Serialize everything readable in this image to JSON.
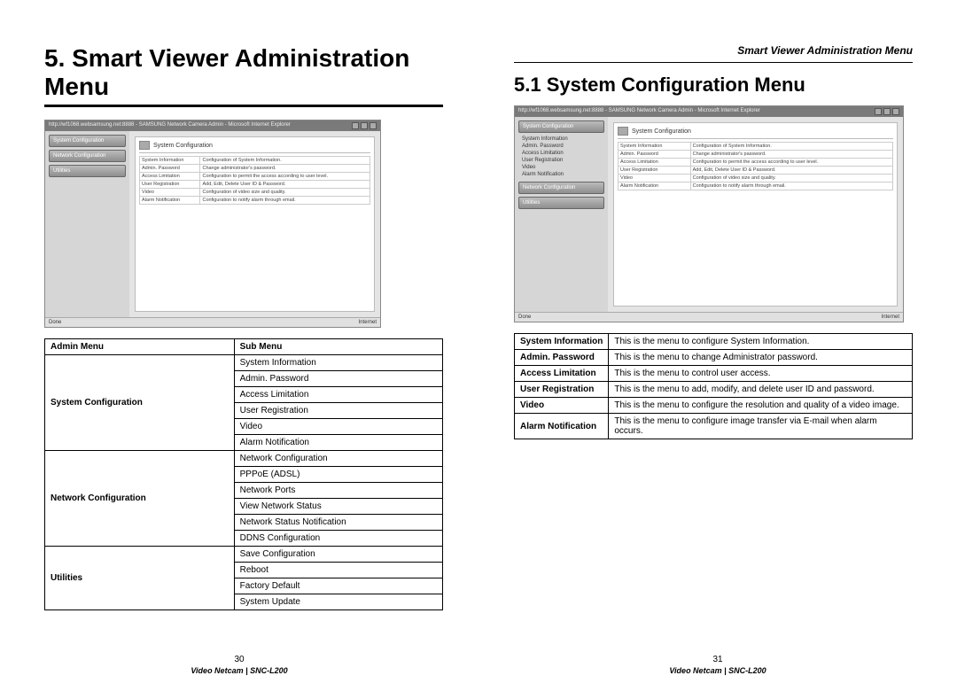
{
  "left": {
    "title": "5. Smart Viewer Administration Menu",
    "screenshot": {
      "titlebar": "http://wf1068.websamsung.net:8888 - SAMSUNG Network Camera Admin - Microsoft Internet Explorer",
      "side": {
        "sysconf": "System Configuration",
        "netconf": "Network Configuration",
        "util": "Utilities"
      },
      "main_title": "System Configuration",
      "rows": [
        {
          "k": "System Information",
          "v": "Configuration of System Information."
        },
        {
          "k": "Admin. Password",
          "v": "Change administrator's password."
        },
        {
          "k": "Access Limitation",
          "v": "Configuration to permit the access according to user level."
        },
        {
          "k": "User Registration",
          "v": "Add, Edit, Delete User ID & Password."
        },
        {
          "k": "Video",
          "v": "Configuration of video size and quality."
        },
        {
          "k": "Alarm Notification",
          "v": "Configuration to notify alarm through email."
        }
      ],
      "status_done": "Done",
      "status_net": "Internet"
    },
    "admin_table": {
      "headers": {
        "c1": "Admin Menu",
        "c2": "Sub Menu"
      },
      "groups": [
        {
          "label": "System Configuration",
          "items": [
            "System Information",
            "Admin. Password",
            "Access Limitation",
            "User Registration",
            "Video",
            "Alarm Notification"
          ]
        },
        {
          "label": "Network Configuration",
          "items": [
            "Network Configuration",
            "PPPoE (ADSL)",
            "Network Ports",
            "View Network Status",
            "Network Status Notification",
            "DDNS Configuration"
          ]
        },
        {
          "label": "Utilities",
          "items": [
            "Save Configuration",
            "Reboot",
            "Factory Default",
            "System Update"
          ]
        }
      ]
    },
    "page_number": "30",
    "model": "Video Netcam | SNC-L200"
  },
  "right": {
    "running_head": "Smart Viewer Administration Menu",
    "title": "5.1 System Configuration Menu",
    "screenshot": {
      "titlebar": "http://wf1068.websamsung.net:8888 - SAMSUNG Network Camera Admin - Microsoft Internet Explorer",
      "side": {
        "sysconf": "System Configuration",
        "subs": [
          "System Information",
          "Admin. Password",
          "Access Limitation",
          "User Registration",
          "Video",
          "Alarm Notification"
        ],
        "netconf": "Network Configuration",
        "util": "Utilities"
      },
      "main_title": "System Configuration",
      "rows": [
        {
          "k": "System Information",
          "v": "Configuration of System Information."
        },
        {
          "k": "Admin. Password",
          "v": "Change administrator's password."
        },
        {
          "k": "Access Limitation",
          "v": "Configuration to permit the access according to user level."
        },
        {
          "k": "User Registration",
          "v": "Add, Edit, Delete User ID & Password."
        },
        {
          "k": "Video",
          "v": "Configuration of video size and quality."
        },
        {
          "k": "Alarm Notification",
          "v": "Configuration to notify alarm through email."
        }
      ],
      "status_done": "Done",
      "status_net": "Internet"
    },
    "desc_table": [
      {
        "label": "System Information",
        "desc": "This is the menu to configure System Information."
      },
      {
        "label": "Admin. Password",
        "desc": "This is the menu to change Administrator password."
      },
      {
        "label": "Access Limitation",
        "desc": "This is the menu to control user access."
      },
      {
        "label": "User Registration",
        "desc": "This is the menu to add, modify, and delete user ID and password."
      },
      {
        "label": "Video",
        "desc": "This is the menu to configure the resolution and quality of a video image."
      },
      {
        "label": "Alarm Notification",
        "desc": "This is the menu to configure image transfer via E-mail when alarm occurs."
      }
    ],
    "page_number": "31",
    "model": "Video Netcam | SNC-L200"
  }
}
